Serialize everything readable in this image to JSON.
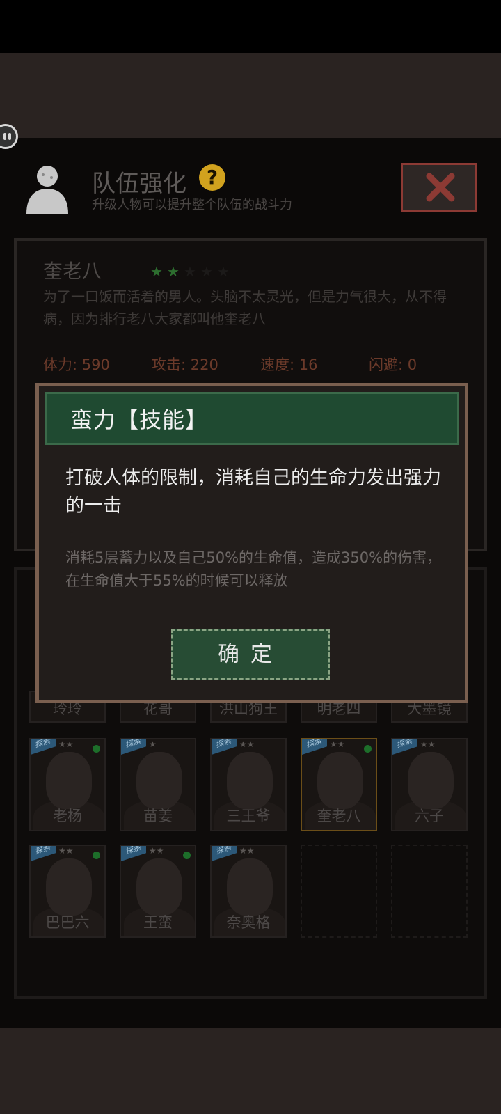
{
  "header": {
    "title": "队伍强化",
    "help_glyph": "?",
    "subtitle": "升级人物可以提升整个队伍的战斗力"
  },
  "character": {
    "name": "奎老八",
    "stars_filled": 2,
    "stars_total": 5,
    "description": "为了一口饭而活着的男人。头脑不太灵光，但是力气很大，从不得病，因为排行老八大家都叫他奎老八",
    "stats": {
      "hp": "体力: 590",
      "attack": "攻击: 220",
      "speed": "速度: 16",
      "dodge": "闪避: 0"
    }
  },
  "roster": {
    "row1": [
      "玲玲",
      "花哥",
      "洪山狗王",
      "明老四",
      "大墨镜"
    ],
    "row2": [
      "老杨",
      "苗姜",
      "三王爷",
      "奎老八",
      "六子"
    ],
    "row3": [
      "巴巴六",
      "王蛮",
      "奈奥格"
    ],
    "badge": "探索",
    "stars": "★★",
    "selected": "奎老八"
  },
  "modal": {
    "title": "蛮力【技能】",
    "main": "打破人体的限制，消耗自己的生命力发出强力的一击",
    "detail": "消耗5层蓄力以及自己50%的生命值，造成350%的伤害，在生命值大于55%的时候可以释放",
    "confirm": "确定"
  },
  "colors": {
    "modal_header": "#1f4a31",
    "confirm_button": "#274c34",
    "help_icon": "#d1a21e",
    "close_border": "#8c3a34",
    "star_filled": "#2d6e2f",
    "online_dot": "#1d6e2a"
  }
}
